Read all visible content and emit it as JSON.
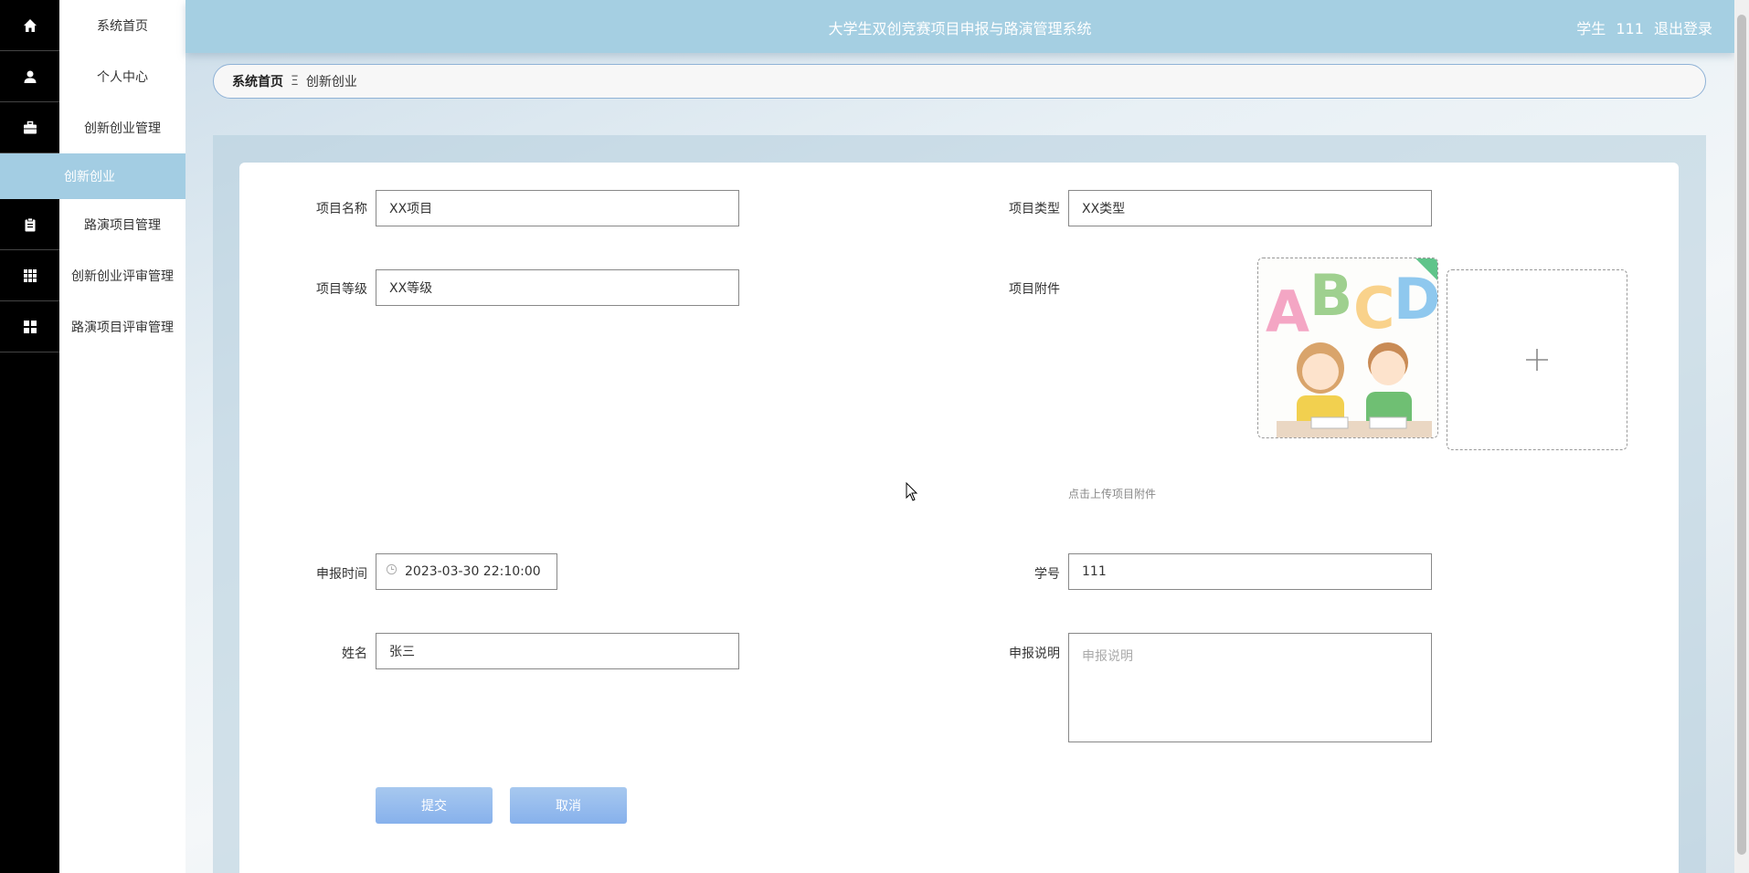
{
  "header": {
    "title": "大学生双创竞赛项目申报与路演管理系统",
    "user": "学生 111",
    "logout": "退出登录"
  },
  "sidebar": {
    "items": [
      {
        "label": "系统首页",
        "icon": "home-icon"
      },
      {
        "label": "个人中心",
        "icon": "user-icon"
      },
      {
        "label": "创新创业管理",
        "icon": "briefcase-icon"
      },
      {
        "label": "创新创业",
        "icon": ""
      },
      {
        "label": "路演项目管理",
        "icon": "clipboard-icon"
      },
      {
        "label": "创新创业评审管理",
        "icon": "grid-icon"
      },
      {
        "label": "路演项目评审管理",
        "icon": "dashboard-icon"
      }
    ]
  },
  "breadcrumb": {
    "home": "系统首页",
    "separator": "Ξ",
    "current": "创新创业"
  },
  "form": {
    "project_name": {
      "label": "项目名称",
      "value": "XX项目"
    },
    "project_type": {
      "label": "项目类型",
      "value": "XX类型"
    },
    "project_level": {
      "label": "项目等级",
      "value": "XX等级"
    },
    "attachment": {
      "label": "项目附件",
      "hint": "点击上传项目附件"
    },
    "apply_time": {
      "label": "申报时间",
      "value": "2023-03-30 22:10:00"
    },
    "student_id": {
      "label": "学号",
      "value": "111"
    },
    "name": {
      "label": "姓名",
      "value": "张三"
    },
    "description": {
      "label": "申报说明",
      "placeholder": "申报说明"
    }
  },
  "buttons": {
    "submit": "提交",
    "cancel": "取消"
  }
}
